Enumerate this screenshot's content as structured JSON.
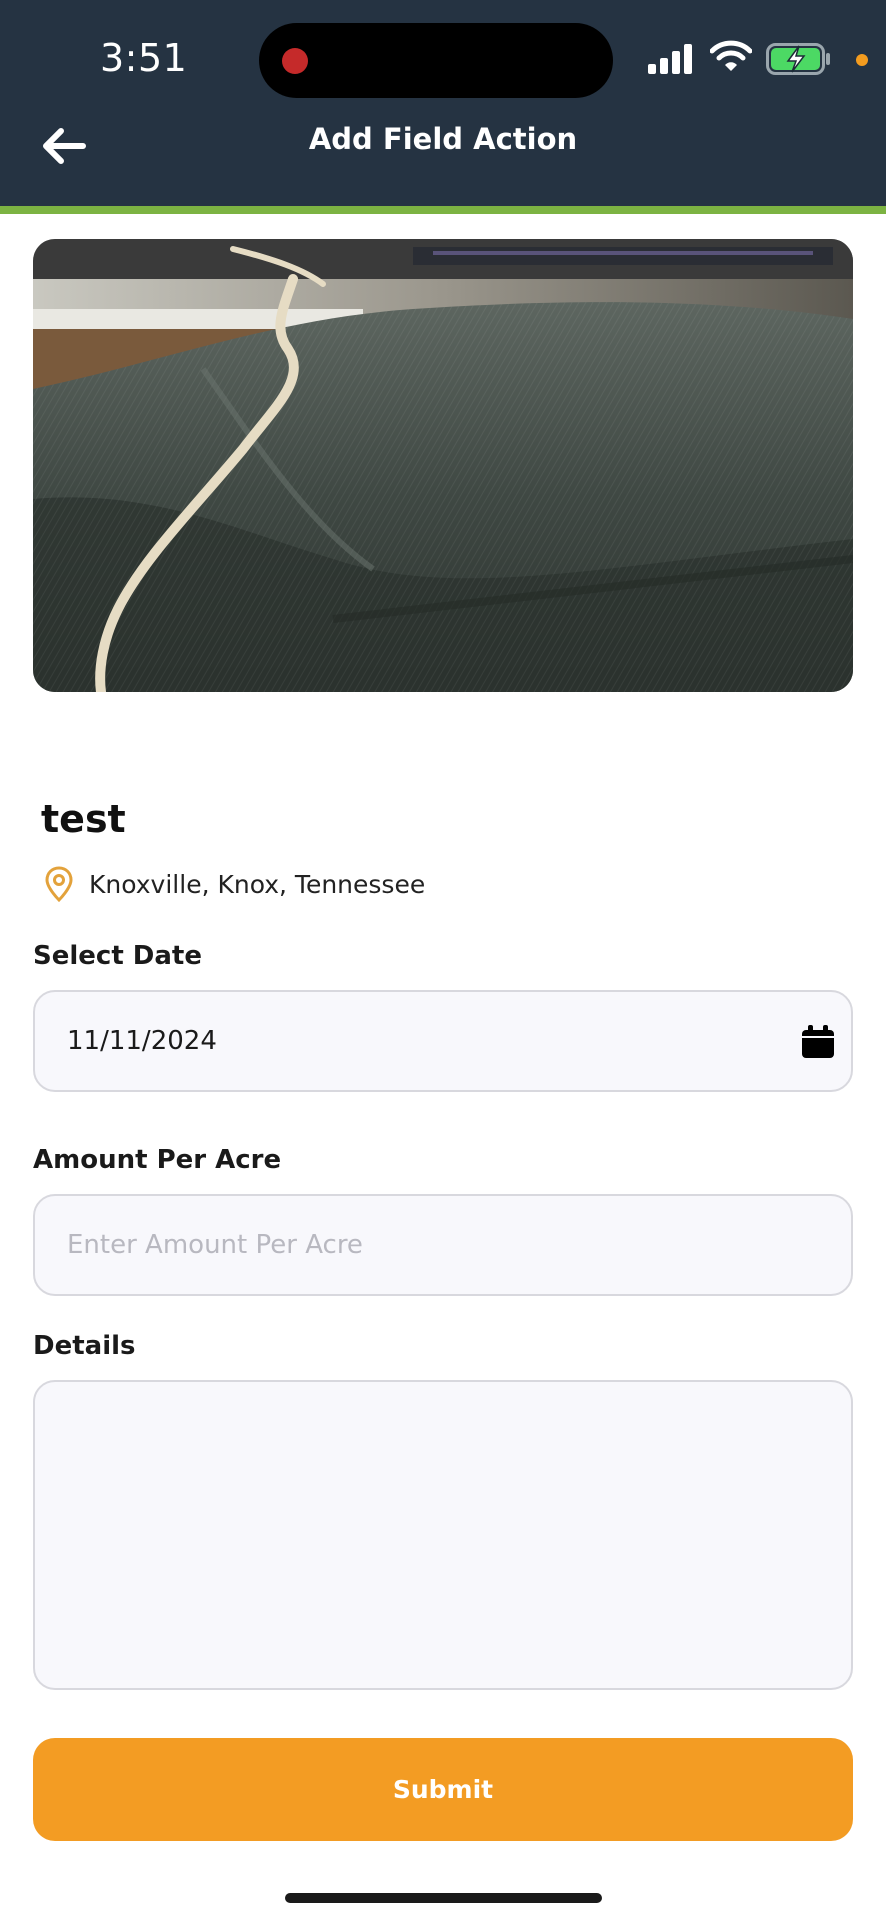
{
  "status_bar": {
    "time": "3:51",
    "icons": [
      "signal-icon",
      "wifi-icon",
      "battery-charging-icon"
    ]
  },
  "header": {
    "title": "Add Field Action",
    "back_icon": "arrow-left-icon"
  },
  "field": {
    "name": "test",
    "location": "Knoxville, Knox, Tennessee",
    "location_icon": "map-pin-icon"
  },
  "form": {
    "date_label": "Select Date",
    "date_value": "11/11/2024",
    "date_icon": "calendar-icon",
    "amount_label": "Amount Per Acre",
    "amount_placeholder": "Enter Amount Per Acre",
    "amount_value": "",
    "details_label": "Details",
    "details_value": ""
  },
  "submit_label": "Submit",
  "colors": {
    "header_bg": "#253342",
    "accent_green": "#7cb342",
    "accent_orange": "#f39c23"
  }
}
